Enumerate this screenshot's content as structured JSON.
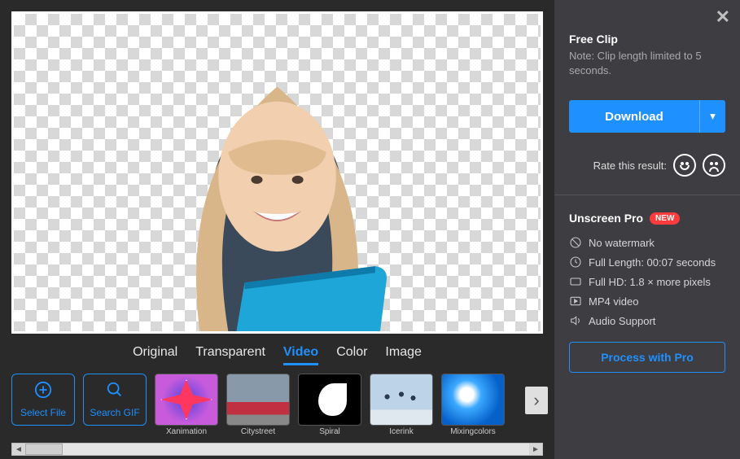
{
  "tabs": {
    "original": "Original",
    "transparent": "Transparent",
    "video": "Video",
    "color": "Color",
    "image": "Image",
    "active": "video"
  },
  "actions": {
    "select_file": "Select File",
    "search_gif": "Search GIF"
  },
  "thumbs": [
    {
      "id": "xanimation",
      "label": "Xanimation"
    },
    {
      "id": "citystreet",
      "label": "Citystreet"
    },
    {
      "id": "spiral",
      "label": "Spiral"
    },
    {
      "id": "icerink",
      "label": "Icerink"
    },
    {
      "id": "mixingcolors",
      "label": "Mixingcolors"
    }
  ],
  "side": {
    "free_title": "Free Clip",
    "free_note": "Note: Clip length limited to 5 seconds.",
    "download": "Download",
    "rate_label": "Rate this result:",
    "pro_title": "Unscreen Pro",
    "new_badge": "NEW",
    "features": {
      "no_watermark": "No watermark",
      "full_length": "Full Length: 00:07 seconds",
      "full_hd": "Full HD: 1.8 × more pixels",
      "mp4": "MP4 video",
      "audio": "Audio Support"
    },
    "process": "Process with Pro"
  }
}
